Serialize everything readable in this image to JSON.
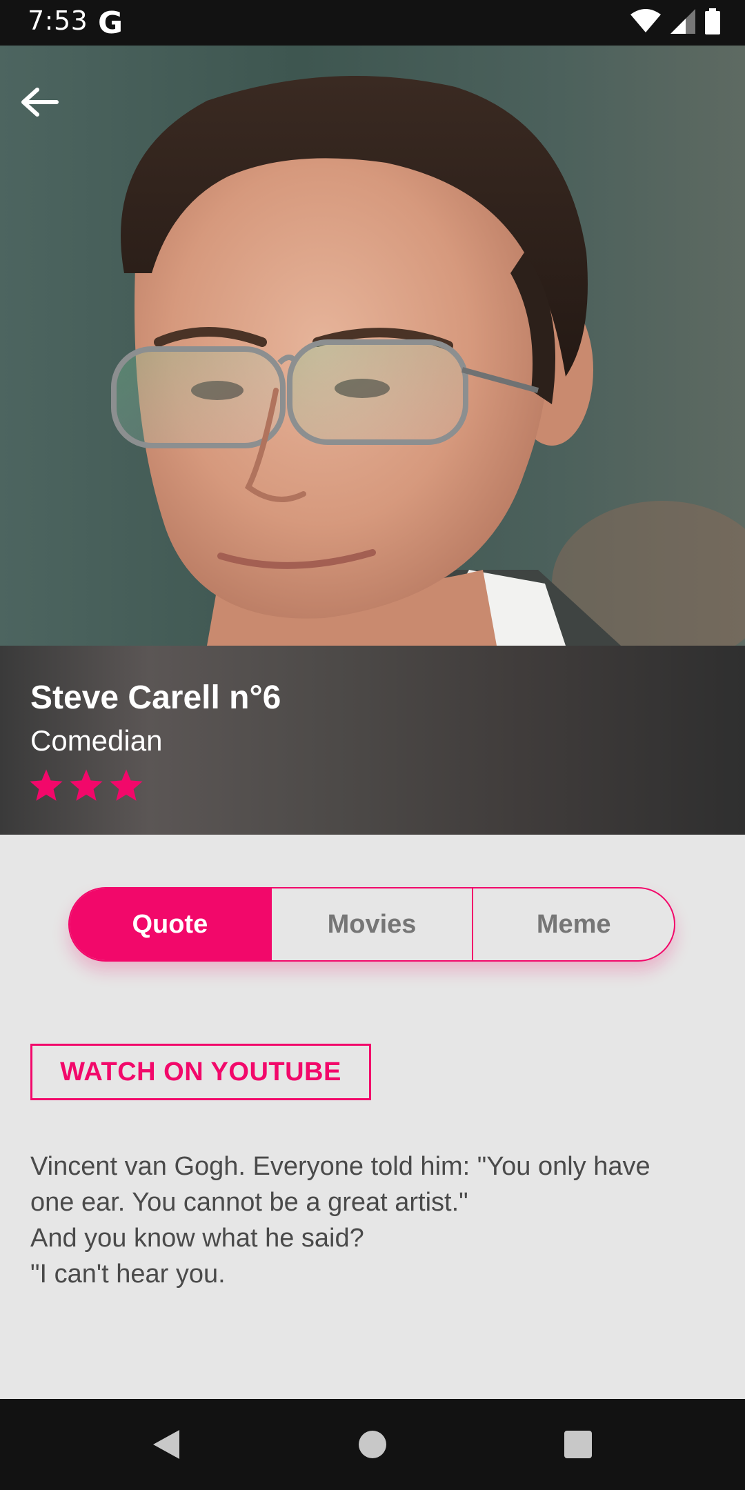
{
  "status_bar": {
    "time": "7:53",
    "g_label": "G"
  },
  "profile": {
    "name": "Steve Carell n°6",
    "role": "Comedian",
    "rating_stars": 3,
    "accent_color": "#f2086a"
  },
  "tabs": [
    {
      "label": "Quote",
      "active": true
    },
    {
      "label": "Movies",
      "active": false
    },
    {
      "label": "Meme",
      "active": false
    }
  ],
  "youtube_button_label": "WATCH ON YOUTUBE",
  "quote": {
    "lines": [
      "Vincent van Gogh. Everyone told him: \"You only have",
      "one ear. You cannot be a great artist.\"",
      "And you know what he said?",
      "\"I can't hear you."
    ]
  },
  "icons": {
    "back": "arrow-left-icon",
    "wifi": "wifi-icon",
    "signal": "signal-icon",
    "battery": "battery-icon",
    "nav_back": "triangle-back-icon",
    "nav_home": "circle-home-icon",
    "nav_recents": "square-recents-icon"
  }
}
